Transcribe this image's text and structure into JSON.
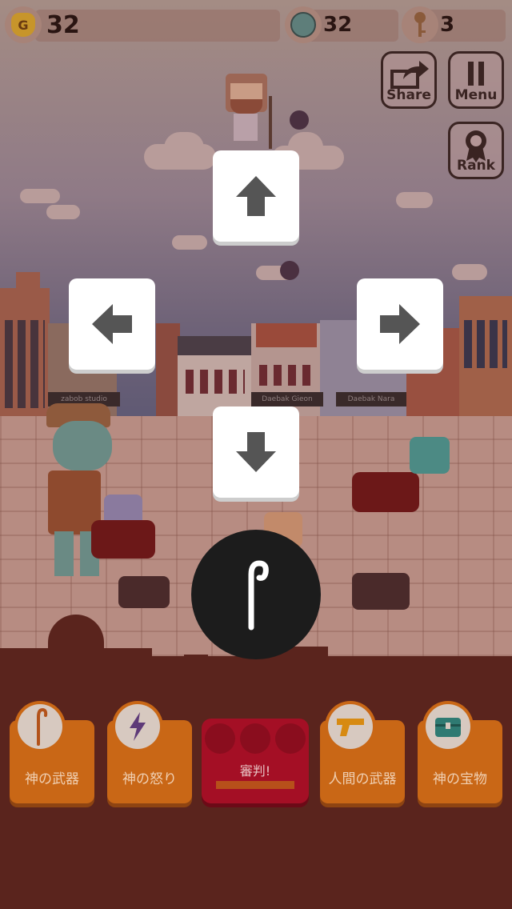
{
  "hud": {
    "gold_icon_letter": "G",
    "gold": "32",
    "zombies": "32",
    "keys": "3"
  },
  "corner_buttons": {
    "share": "Share",
    "menu": "Menu",
    "rank": "Rank"
  },
  "signs": [
    "zabob studio",
    "Daebak Gieon",
    "Daebak Nara"
  ],
  "bottom_bar": {
    "god_weapon": "神の武器",
    "god_wrath": "神の怒り",
    "judgement": "審判!",
    "human_weapon": "人間の武器",
    "god_treasure": "神の宝物"
  },
  "colors": {
    "card_orange": "#c96716",
    "judge_red": "#a40f25",
    "arrow_key": "#ffffff",
    "arrow_glyph": "#555555"
  },
  "icons": {
    "gold": "money-bag-icon",
    "zombie": "zombie-head-icon",
    "key": "key-icon",
    "share": "share-arrow-icon",
    "menu": "pause-icon",
    "rank": "ribbon-badge-icon",
    "staff": "staff-icon",
    "wrath": "lightning-icon",
    "gun": "gun-icon",
    "chest": "treasure-chest-icon"
  }
}
